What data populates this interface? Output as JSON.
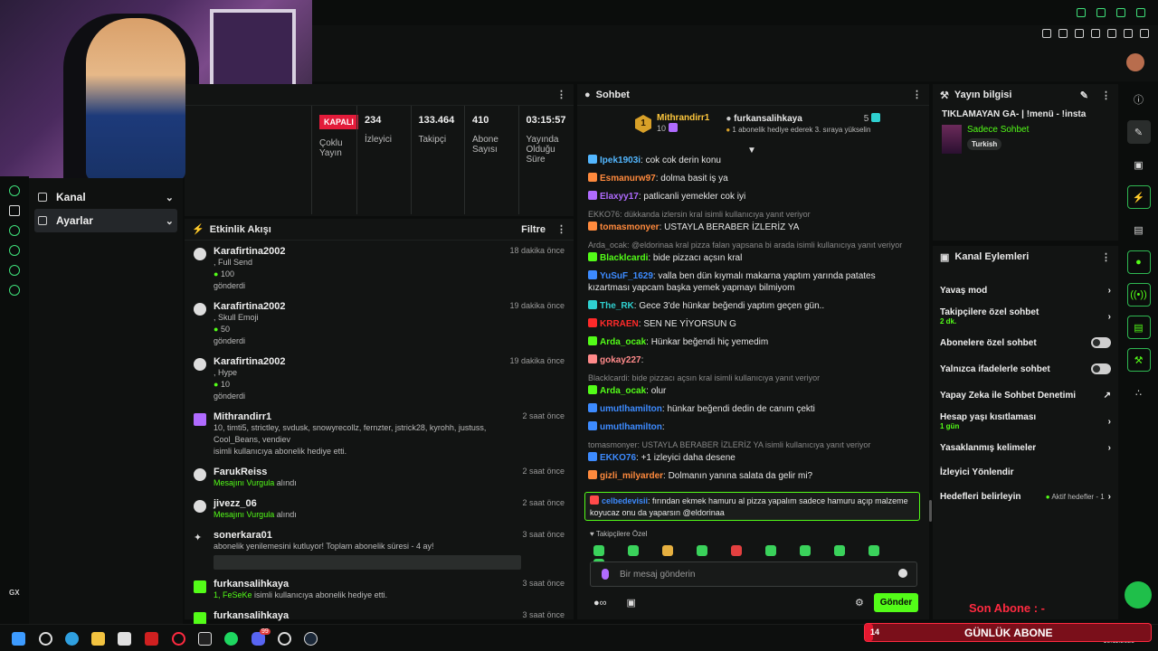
{
  "stats": {
    "status_badge": "KAPALI",
    "items": [
      {
        "value": "",
        "label": "Çoklu Yayın"
      },
      {
        "value": "234",
        "label": "İzleyici"
      },
      {
        "value": "133.464",
        "label": "Takipçi"
      },
      {
        "value": "410",
        "label": "Abone Sayısı"
      },
      {
        "value": "03:15:57",
        "label": "Yayında Olduğu Süre"
      }
    ]
  },
  "sidenav": {
    "items": [
      {
        "label": "Kanal"
      },
      {
        "label": "Ayarlar"
      }
    ]
  },
  "activity": {
    "title": "Etkinlik Akışı",
    "filter": "Filtre",
    "items": [
      {
        "name": "Karafirtina2002",
        "detail": ", Full Send",
        "amount": "100",
        "note": "gönderdi",
        "time": "18 dakika önce"
      },
      {
        "name": "Karafirtina2002",
        "detail": ", Skull Emoji",
        "amount": "50",
        "note": "gönderdi",
        "time": "19 dakika önce"
      },
      {
        "name": "Karafirtina2002",
        "detail": ", Hype",
        "amount": "10",
        "note": "gönderdi",
        "time": "19 dakika önce"
      },
      {
        "name": "Mithrandirr1",
        "detail": "10, timti5, strictley, svdusk, snowyrecollz, fernzter, jstrick28, kyrohh, justuss, Cool_Beans, vendiev",
        "note": "isimli kullanıcıya abonelik hediye etti.",
        "time": "2 saat önce"
      },
      {
        "name": "FarukReiss",
        "detail": "Mesajını Vurgula",
        "note": "alındı",
        "time": "2 saat önce"
      },
      {
        "name": "jivezz_06",
        "detail": "Mesajını Vurgula",
        "note": "alındı",
        "time": "2 saat önce"
      },
      {
        "name": "sonerkara01",
        "detail": "abonelik yenilemesini kutluyor! Toplam abonelik süresi - 4 ay!",
        "time": "3 saat önce"
      },
      {
        "name": "furkansalihkaya",
        "detail": "1, FeSeKe",
        "note": "isimli kullanıcıya abonelik hediye etti.",
        "time": "3 saat önce"
      },
      {
        "name": "furkansalihkaya",
        "time": "3 saat önce"
      }
    ]
  },
  "chat": {
    "title": "Sohbet",
    "gift": {
      "user": "Mithrandirr1",
      "count": "10",
      "target": "furkansalihkaya",
      "target_count": "5",
      "rank": "1",
      "note": "1 abonelik hediye ederek 3. sıraya yükselin"
    },
    "messages": [
      {
        "user": "Ipek1903i",
        "text": ": cok cok derin konu",
        "color": "#53b7ff"
      },
      {
        "user": "Esmanurw97",
        "text": ": dolma basit iş ya",
        "color": "#ff8a3d"
      },
      {
        "user": "Elaxyy17",
        "text": ": patlicanli yemekler cok iyi",
        "color": "#b06bff"
      },
      {
        "reply": "EKKO76: dükkanda izlersin kral isimli kullanıcıya yanıt veriyor",
        "user": "tomasmonyer",
        "text": ": USTAYLA BERABER İZLERİZ YA",
        "color": "#ff8a3d"
      },
      {
        "reply": "Arda_ocak: @eldorinaa kral pizza falan yapsana bi arada isimli kullanıcıya yanıt veriyor",
        "user": "Blacklcardi",
        "text": ": bide pizzacı açsın kral",
        "color": "#53fc18"
      },
      {
        "user": "YuSuF_1629",
        "text": ": valla ben dün kıymalı makarna yaptım yarında patates kızartması yapcam başka yemek yapmayı bilmiyom",
        "color": "#3d8bff"
      },
      {
        "user": "The_RK",
        "text": ": Gece 3'de hünkar beğendi yaptım geçen gün..",
        "color": "#2fd0d0"
      },
      {
        "user": "KRRAEN",
        "text": ": SEN NE YİYORSUN G",
        "color": "#ff2a2a"
      },
      {
        "user": "Arda_ocak",
        "text": ": Hünkar beğendi hiç yemedim",
        "color": "#53fc18"
      },
      {
        "user": "gokay227",
        "text": ":",
        "color": "#ff8a8a"
      },
      {
        "reply": "Blacklcardi: bide pizzacı açsın kral isimli kullanıcıya yanıt veriyor",
        "user": "Arda_ocak",
        "text": ": olur",
        "color": "#53fc18"
      },
      {
        "user": "umutlhamilton",
        "text": ": hünkar beğendi dedin de canım çekti",
        "color": "#3d8bff"
      },
      {
        "user": "umutlhamilton",
        "text": ":",
        "color": "#3d8bff"
      },
      {
        "reply": "tomasmonyer: USTAYLA BERABER İZLERİZ YA isimli kullanıcıya yanıt veriyor",
        "user": "EKKO76",
        "text": ": +1 izleyici daha desene",
        "color": "#3d8bff"
      },
      {
        "user": "gizli_milyarder",
        "text": ": Dolmanın yanına salata da gelir mi?",
        "color": "#ff8a3d"
      }
    ],
    "highlight": {
      "user": "celbedevisii",
      "text": ": fırından ekmek hamuru al pizza yapalım sadece hamuru açıp malzeme koyucaz onu da yaparsın @eldorinaa"
    },
    "emote_label": "Takipçilere Özel",
    "input_placeholder": "Bir mesaj gönderin",
    "send_label": "Gönder"
  },
  "info": {
    "title": "Yayın bilgisi",
    "stream_title": "TIKLAMAYAN GA- | !menü - !insta",
    "category": "Sadece Sohbet",
    "tag": "Turkish"
  },
  "actions": {
    "title": "Kanal Eylemleri",
    "items": [
      {
        "label": "Yavaş mod"
      },
      {
        "label": "Takipçilere özel sohbet",
        "sub": "2 dk."
      },
      {
        "label": "Abonelere özel sohbet"
      },
      {
        "label": "Yalnızca ifadelerle sohbet"
      },
      {
        "label": "Yapay Zeka ile Sohbet Denetimi"
      },
      {
        "label": "Hesap yaşı kısıtlaması",
        "sub": "1 gün"
      },
      {
        "label": "Yasaklanmış kelimeler"
      },
      {
        "label": "İzleyici Yönlendir"
      },
      {
        "label": "Hedefleri belirleyin",
        "extra": "Aktif hedefler - 1"
      }
    ]
  },
  "overlay": {
    "son_abone": "Son Abone : -",
    "gunluk": "GÜNLÜK ABONE",
    "count": "14",
    "progress": 0.03,
    "time": "20",
    "date": "10.11.2025"
  },
  "taskbar": {
    "discord_badge": "99"
  },
  "leftrail_label": "GX"
}
